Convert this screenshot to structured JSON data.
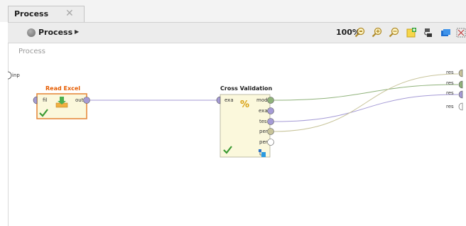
{
  "tab": {
    "label": "Process",
    "close_icon": "close-icon"
  },
  "toolbar": {
    "breadcrumb_label": "Process",
    "zoom": "100%",
    "icons": [
      "zoom-fit-icon",
      "zoom-in-icon",
      "zoom-out-icon",
      "add-note-icon",
      "auto-wire-icon",
      "layers-icon",
      "arrange-icon"
    ]
  },
  "canvas": {
    "title": "Process",
    "input_port": "inp",
    "output_ports": [
      "res",
      "res",
      "res",
      "res"
    ]
  },
  "operators": {
    "read_excel": {
      "title": "Read Excel",
      "in_port": "fil",
      "out_port": "out",
      "title_color": "#e65c00"
    },
    "cross_validation": {
      "title": "Cross Validation",
      "in_port": "exa",
      "out_ports": [
        "mod",
        "exa",
        "tes",
        "per",
        "per"
      ]
    }
  },
  "colors": {
    "model_wire": "#8fb27a",
    "example_wire": "#a59bd6",
    "perf_wire": "#c8c49a",
    "operator_fill": "#fbf8dc",
    "selected_border": "#e68a3e"
  }
}
